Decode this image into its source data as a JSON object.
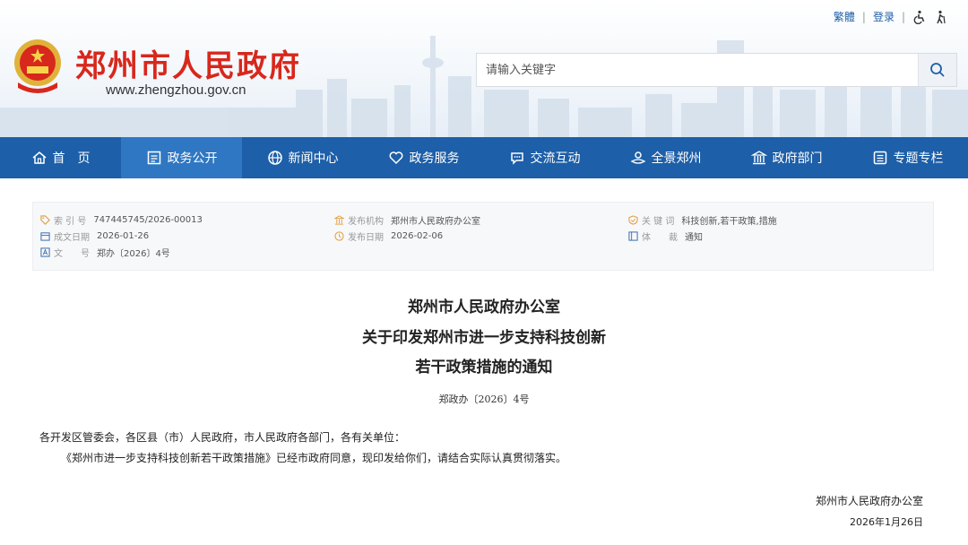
{
  "header": {
    "site_title": "郑州市人民政府",
    "site_url": "www.zhengzhou.gov.cn",
    "top_links": {
      "traditional": "繁體",
      "login": "登录",
      "separator": "|"
    },
    "search": {
      "placeholder": "请输入关键字"
    },
    "icons": [
      "national-emblem-icon",
      "accessibility-icon",
      "elderly-mode-icon",
      "search-icon"
    ]
  },
  "nav": {
    "items": [
      {
        "label": "首　页",
        "icon": "home-icon"
      },
      {
        "label": "政务公开",
        "icon": "document-icon",
        "active": true
      },
      {
        "label": "新闻中心",
        "icon": "globe-icon"
      },
      {
        "label": "政务服务",
        "icon": "heart-icon"
      },
      {
        "label": "交流互动",
        "icon": "chat-icon"
      },
      {
        "label": "全景郑州",
        "icon": "panorama-icon"
      },
      {
        "label": "政府部门",
        "icon": "building-icon"
      },
      {
        "label": "专题专栏",
        "icon": "list-icon"
      }
    ]
  },
  "meta": {
    "index_label": "索 引 号",
    "index_value": "747445745/2026-00013",
    "created_label": "成文日期",
    "created_value": "2026-01-26",
    "docno_label": "文　　号",
    "docno_value": "郑办〔2026〕4号",
    "org_label": "发布机构",
    "org_value": "郑州市人民政府办公室",
    "published_label": "发布日期",
    "published_value": "2026-02-06",
    "keywords_label": "关 键 词",
    "keywords_value": "科技创新,若干政策,措施",
    "genre_label": "体　　裁",
    "genre_value": "通知"
  },
  "document": {
    "issuer": "郑州市人民政府办公室",
    "title_line1": "关于印发郑州市进一步支持科技创新",
    "title_line2": "若干政策措施的通知",
    "number": "郑政办〔2026〕4号",
    "salutation": "各开发区管委会，各区县（市）人民政府，市人民政府各部门，各有关单位：",
    "body": "《郑州市进一步支持科技创新若干政策措施》已经市政府同意，现印发给你们，请结合实际认真贯彻落实。",
    "signature": "郑州市人民政府办公室",
    "date": "2026年1月26日"
  },
  "colors": {
    "brand_red": "#d8271c",
    "nav_blue": "#1d5fa8",
    "nav_active": "#2f77c2",
    "link_blue": "#1f5fa8"
  }
}
